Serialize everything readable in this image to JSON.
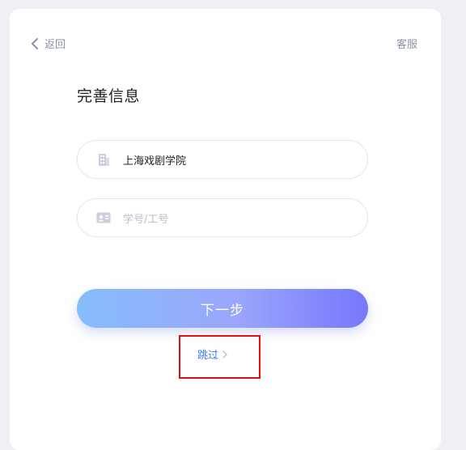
{
  "header": {
    "back_label": "返回",
    "service_label": "客服"
  },
  "form": {
    "title": "完善信息",
    "school": {
      "value": "上海戏剧学院",
      "icon": "building-icon"
    },
    "id_field": {
      "placeholder": "学号/工号",
      "value": "",
      "icon": "id-card-icon"
    },
    "next_label": "下一步",
    "skip_label": "跳过"
  },
  "colors": {
    "background": "#eef0f5",
    "accent_link": "#3b7cf0",
    "button_gradient_start": "#86bdfb",
    "button_gradient_end": "#7677fb",
    "highlight_box": "#e01010"
  }
}
